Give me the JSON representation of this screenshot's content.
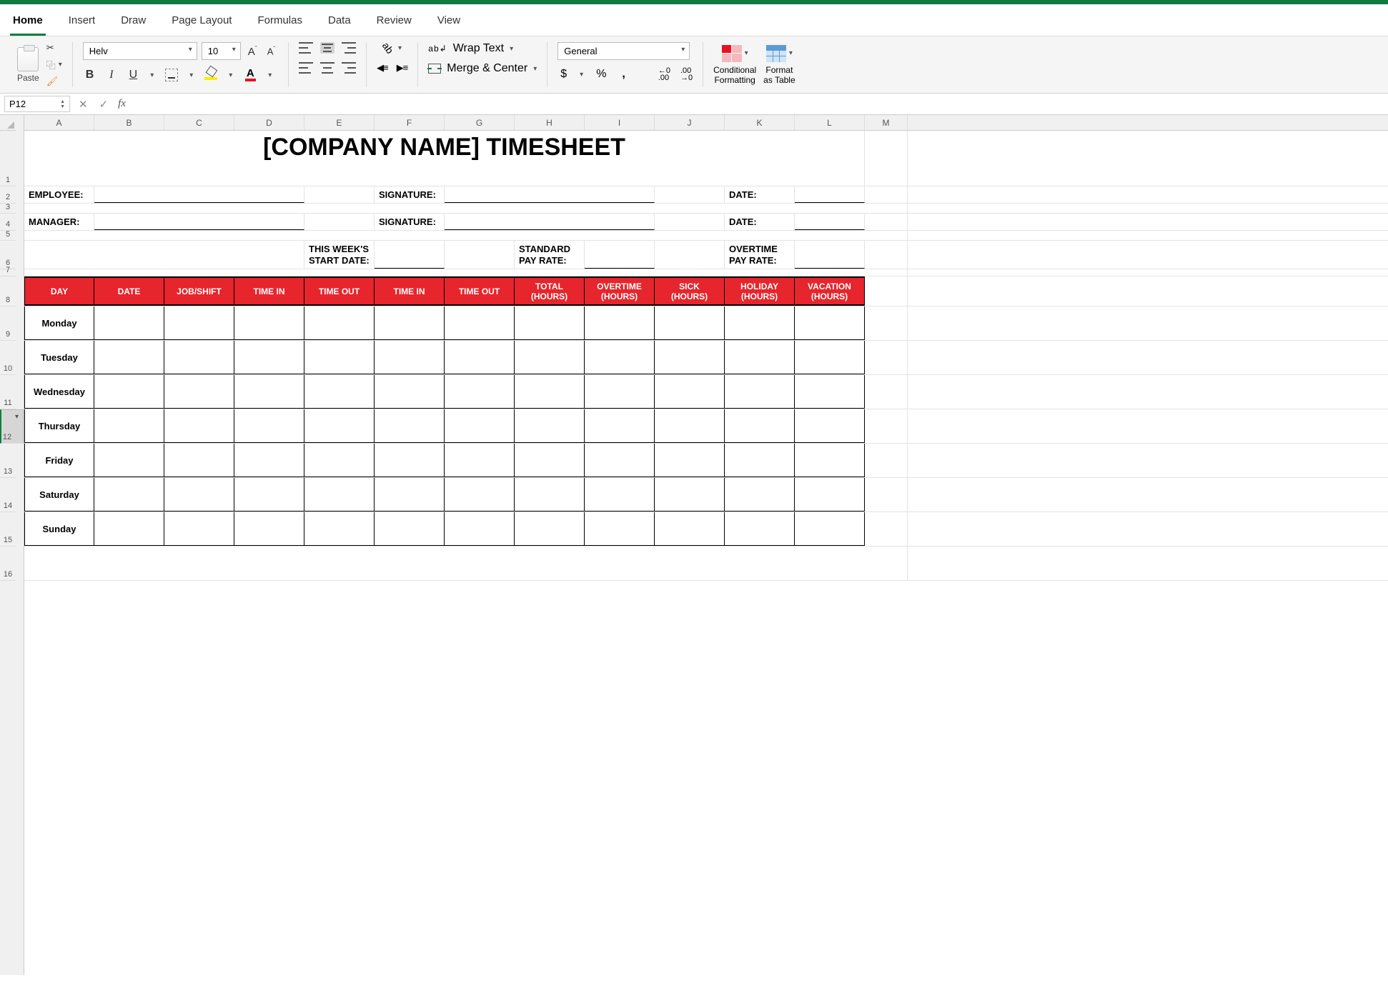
{
  "tabs": [
    "Home",
    "Insert",
    "Draw",
    "Page Layout",
    "Formulas",
    "Data",
    "Review",
    "View"
  ],
  "active_tab": "Home",
  "ribbon": {
    "paste": "Paste",
    "font_name": "Helv",
    "font_size": "10",
    "wrap_text": "Wrap Text",
    "merge_center": "Merge & Center",
    "number_format": "General",
    "cond_fmt_l1": "Conditional",
    "cond_fmt_l2": "Formatting",
    "fmt_table_l1": "Format",
    "fmt_table_l2": "as Table"
  },
  "name_box": "P12",
  "formula": "",
  "columns": [
    "A",
    "B",
    "C",
    "D",
    "E",
    "F",
    "G",
    "H",
    "I",
    "J",
    "K",
    "L",
    "M"
  ],
  "row_heights": {
    "r1": 78,
    "r2": 24,
    "r3": 14,
    "r4": 24,
    "r5": 14,
    "r6": 40,
    "r7": 10,
    "r8": 42,
    "r9": 48,
    "r10": 48,
    "r11": 48,
    "r12": 48,
    "r13": 48,
    "r14": 48,
    "r15": 48,
    "r16": 48
  },
  "sheet": {
    "title": "[COMPANY NAME] TIMESHEET",
    "employee_lbl": "EMPLOYEE:",
    "manager_lbl": "MANAGER:",
    "signature_lbl": "SIGNATURE:",
    "date_lbl": "DATE:",
    "week_start_l1": "THIS WEEK'S",
    "week_start_l2": "START DATE:",
    "std_rate_l1": "STANDARD",
    "std_rate_l2": "PAY RATE:",
    "ot_rate_l1": "OVERTIME",
    "ot_rate_l2": "PAY RATE:",
    "headers": [
      "DAY",
      "DATE",
      "JOB/SHIFT",
      "TIME IN",
      "TIME OUT",
      "TIME IN",
      "TIME OUT",
      "TOTAL\n(HOURS)",
      "OVERTIME\n(HOURS)",
      "SICK\n(HOURS)",
      "HOLIDAY\n(HOURS)",
      "VACATION\n(HOURS)"
    ],
    "days": [
      "Monday",
      "Tuesday",
      "Wednesday",
      "Thursday",
      "Friday",
      "Saturday",
      "Sunday"
    ]
  }
}
